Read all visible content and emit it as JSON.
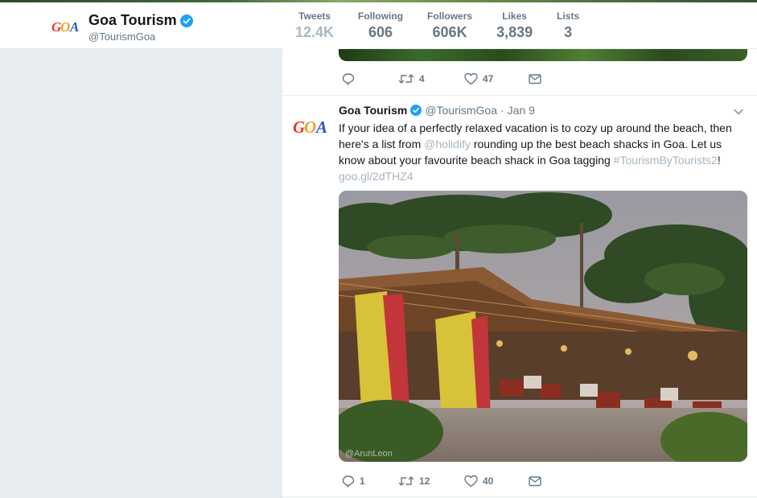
{
  "profile": {
    "name": "Goa Tourism",
    "handle": "@TourismGoa",
    "logo_text": "GOA"
  },
  "stats": [
    {
      "label": "Tweets",
      "value": "12.4K",
      "active": true
    },
    {
      "label": "Following",
      "value": "606"
    },
    {
      "label": "Followers",
      "value": "606K"
    },
    {
      "label": "Likes",
      "value": "3,839"
    },
    {
      "label": "Lists",
      "value": "3"
    }
  ],
  "previous_tweet": {
    "actions": {
      "reply": "",
      "retweets": "4",
      "likes": "47"
    }
  },
  "tweet": {
    "name": "Goa Tourism",
    "handle": "@TourismGoa",
    "dot": "·",
    "time": "Jan 9",
    "text_parts": {
      "p1": "If your idea of a perfectly relaxed vacation is to cozy up around the beach,  then here's a list from ",
      "mention": "@holidify",
      "p2": " rounding up the best beach shacks in Goa. Let us know about your favourite beach shack in Goa tagging ",
      "hashtag": "#TourismByTourists2",
      "p3": "!",
      "url": "goo.gl/2dTHZ4"
    },
    "image_watermark": "@ArunLeon",
    "actions": {
      "reply": "1",
      "retweets": "12",
      "likes": "40"
    }
  },
  "colors": {
    "accent": "#1da1f2",
    "link": "#a5b6c2",
    "muted": "#657786",
    "background": "#e6ecf0"
  }
}
